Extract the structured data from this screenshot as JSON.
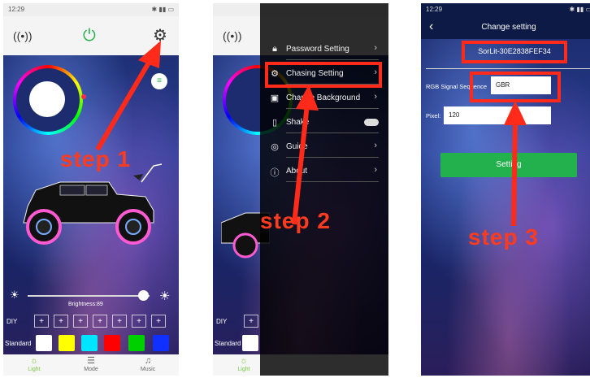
{
  "phone1": {
    "status_time": "12:29",
    "brightness_label": "Brightness:89",
    "diy_label": "DIY",
    "diy_buttons": [
      "+",
      "+",
      "+",
      "+",
      "+",
      "+",
      "+"
    ],
    "standard_label": "Standard",
    "swatches": [
      "#ffffff",
      "#ffff00",
      "#00e5ff",
      "#ff0000",
      "#00d000",
      "#1030ff"
    ],
    "nav": [
      {
        "label": "Light",
        "icon": "☼"
      },
      {
        "label": "Mode",
        "icon": "☰"
      },
      {
        "label": "Music",
        "icon": "♫"
      }
    ],
    "step_label": "step 1"
  },
  "phone2": {
    "menu": [
      {
        "label": "Password Setting",
        "icon": "lock-icon",
        "glyph": "🔒︎",
        "control": "chevron"
      },
      {
        "label": "Chasing Setting",
        "icon": "gear-icon",
        "glyph": "⚙",
        "control": "chevron"
      },
      {
        "label": "Change Background",
        "icon": "image-icon",
        "glyph": "▣",
        "control": "chevron"
      },
      {
        "label": "Shake",
        "icon": "phone-shake-icon",
        "glyph": "▯",
        "control": "toggle"
      },
      {
        "label": "Guide",
        "icon": "compass-icon",
        "glyph": "◎",
        "control": "chevron"
      },
      {
        "label": "About",
        "icon": "info-icon",
        "glyph": "ⓘ",
        "control": "chevron"
      }
    ],
    "step_label": "step 2",
    "nav_light": "Light",
    "standard_label": "Standard",
    "diy_label": "DIY"
  },
  "phone3": {
    "status_time": "12:29",
    "title": "Change setting",
    "device_name": "SorLit-30E2838FEF34",
    "rgb_label": "RGB Signal Sequence",
    "rgb_value": "GBR",
    "pixel_label": "Pixel:",
    "pixel_value": "120",
    "setting_button": "Setting",
    "step_label": "step 3"
  },
  "colors": {
    "accent_red": "#ff2a1a",
    "power_green": "#22b14c",
    "setting_green": "#22b14c"
  }
}
